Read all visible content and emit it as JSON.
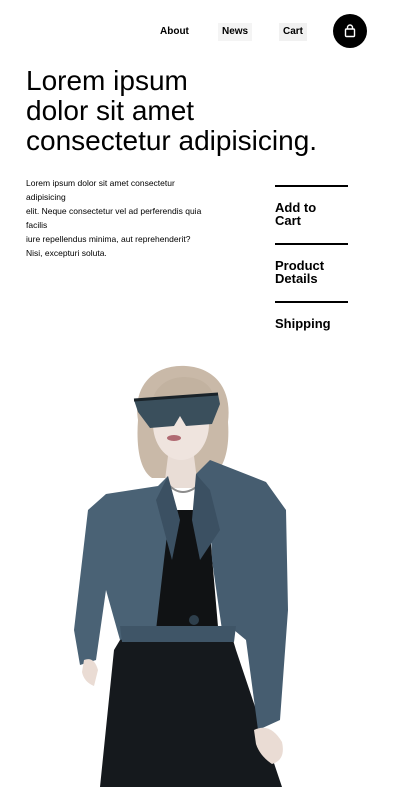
{
  "nav": {
    "items": [
      {
        "label": "About"
      },
      {
        "label": "News"
      },
      {
        "label": "Cart"
      }
    ],
    "cart_icon": "shopping-bag-icon"
  },
  "hero": {
    "title_lines": [
      "Lorem ipsum",
      "dolor sit amet",
      "consectetur adipisicing."
    ]
  },
  "description": {
    "lines": [
      "Lorem ipsum dolor sit amet consectetur",
      "adipisicing",
      "elit. Neque consectetur vel ad perferendis quia",
      "facilis",
      "iure repellendus minima, aut reprehenderit?",
      "Nisi, excepturi soluta."
    ]
  },
  "side_links": [
    {
      "lines": [
        "Add to",
        "Cart"
      ]
    },
    {
      "lines": [
        "Product",
        "Details"
      ]
    },
    {
      "lines": [
        "Shipping"
      ]
    }
  ],
  "colors": {
    "background": "#ffffff",
    "text": "#000000",
    "nav_highlight": "#f2f2f2",
    "jacket": "#4a6275"
  }
}
